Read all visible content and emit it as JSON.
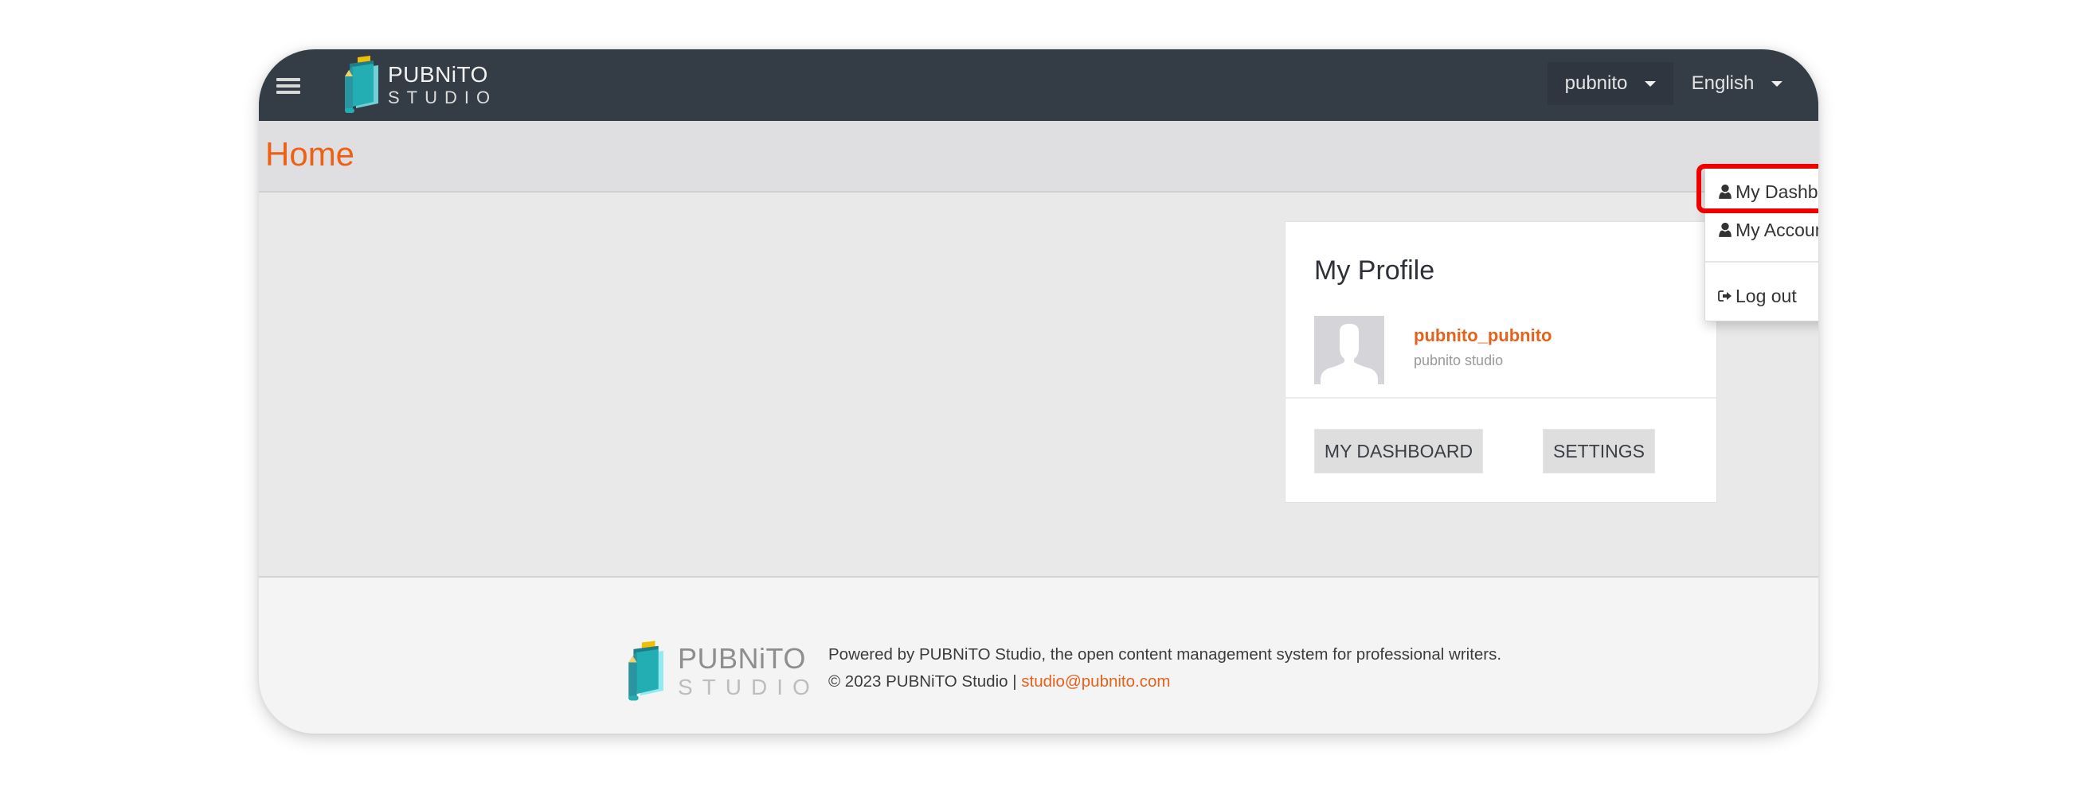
{
  "navbar": {
    "menu_icon": "hamburger-icon",
    "brand": {
      "line1": "PUBNiTO",
      "line2": "STUDIO",
      "icon": "book-pencil-logo"
    },
    "user_menu": {
      "label": "pubnito",
      "icon": "caret-down-icon"
    },
    "language_menu": {
      "label": "English",
      "icon": "caret-down-icon"
    }
  },
  "page": {
    "title": "Home"
  },
  "user_dropdown": {
    "items": [
      {
        "label": "My Dashboard",
        "icon": "user-icon",
        "highlighted": true
      },
      {
        "label": "My Account",
        "icon": "user-icon"
      },
      {
        "label": "Log out",
        "icon": "sign-out-icon"
      }
    ]
  },
  "profile_card": {
    "title": "My Profile",
    "username": "pubnito_pubnito",
    "subtitle": "pubnito studio",
    "avatar": "default-avatar-silhouette",
    "buttons": {
      "dashboard": "MY DASHBOARD",
      "settings": "SETTINGS"
    }
  },
  "footer": {
    "logo": {
      "line1": "PUBNiTO",
      "line2": "STUDIO"
    },
    "powered_by": "Powered by PUBNiTO Studio, the open content management system for professional writers.",
    "copyright": "© 2023 PUBNiTO Studio | ",
    "email": "studio@pubnito.com"
  },
  "colors": {
    "navbar": "#343c46",
    "accent": "#ee6115",
    "highlight": "#ee0000",
    "logo_teal": "#22aeb3",
    "logo_yellow": "#f0c000"
  }
}
